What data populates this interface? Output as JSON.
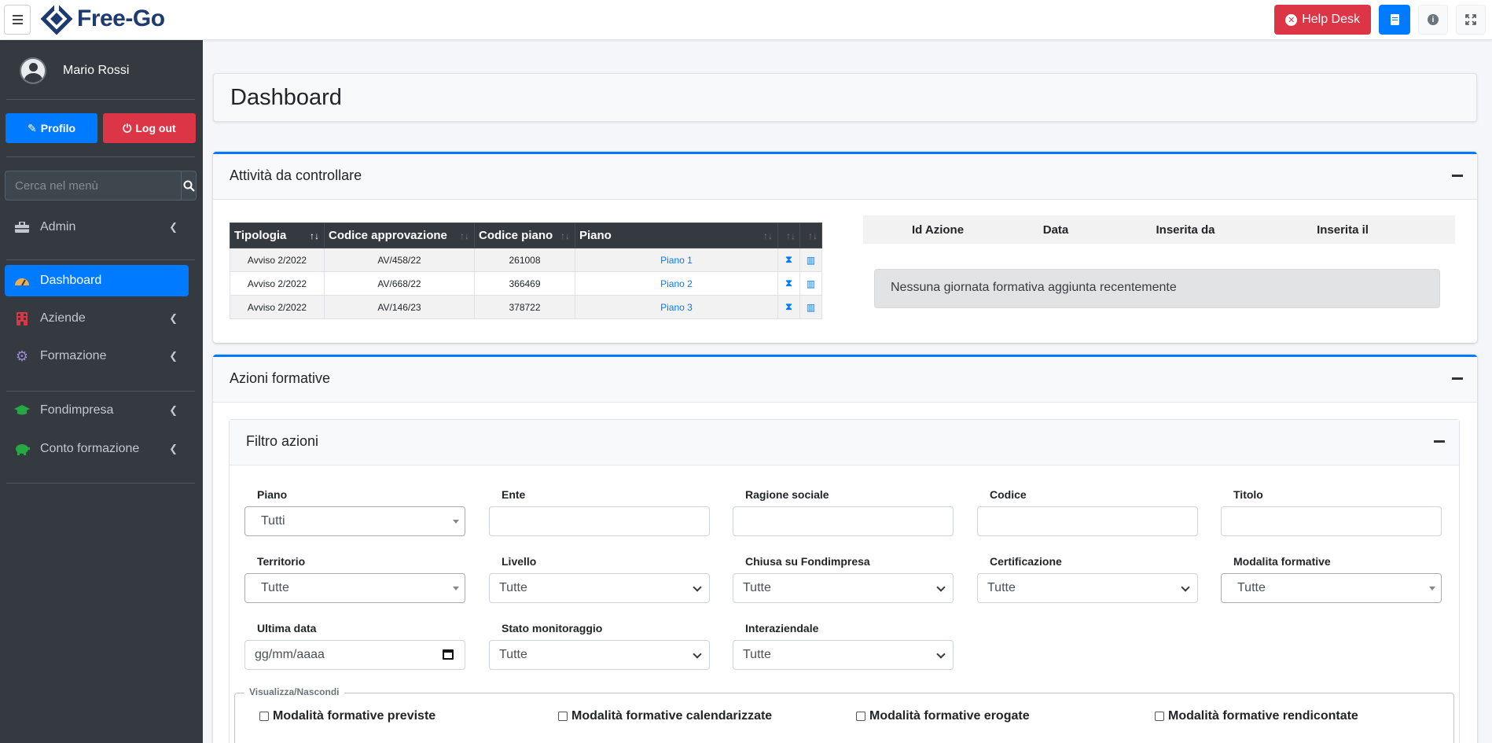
{
  "navbar": {
    "brand": "Free-Go",
    "helpdesk_label": "Help Desk"
  },
  "sidebar": {
    "user_name": "Mario Rossi",
    "profile_label": "Profilo",
    "logout_label": "Log out",
    "search_placeholder": "Cerca nel menù",
    "items": [
      {
        "label": "Admin",
        "icon": "toolbox-icon",
        "has_children": true
      },
      {
        "label": "Dashboard",
        "icon": "dashboard-gauge-icon",
        "active": true
      },
      {
        "label": "Aziende",
        "icon": "building-icon",
        "has_children": true
      },
      {
        "label": "Formazione",
        "icon": "gear-icon",
        "has_children": true
      },
      {
        "label": "Fondimpresa",
        "icon": "graduation-cap-icon",
        "has_children": true
      },
      {
        "label": "Conto formazione",
        "icon": "piggy-bank-icon",
        "has_children": true
      }
    ],
    "colors": {
      "active": "#007bff",
      "background": "#343a40"
    }
  },
  "page": {
    "title": "Dashboard"
  },
  "attivita": {
    "title": "Attività da controllare",
    "columns": [
      "Tipologia",
      "Codice approvazione",
      "Codice piano",
      "Piano"
    ],
    "rows": [
      {
        "tipologia": "Avviso 2/2022",
        "codice_approvazione": "AV/458/22",
        "codice_piano": "261008",
        "piano": "Piano 1"
      },
      {
        "tipologia": "Avviso 2/2022",
        "codice_approvazione": "AV/668/22",
        "codice_piano": "366469",
        "piano": "Piano 2"
      },
      {
        "tipologia": "Avviso 2/2022",
        "codice_approvazione": "AV/146/23",
        "codice_piano": "378722",
        "piano": "Piano 3"
      }
    ],
    "recent_columns": [
      "Id Azione",
      "Data",
      "Inserita da",
      "Inserita il"
    ],
    "empty_message": "Nessuna giornata formativa aggiunta recentemente"
  },
  "azioni": {
    "title": "Azioni formative",
    "filter_title": "Filtro azioni",
    "fields": {
      "piano": {
        "label": "Piano",
        "value": "Tutti"
      },
      "ente": {
        "label": "Ente",
        "value": ""
      },
      "ragione_sociale": {
        "label": "Ragione sociale",
        "value": ""
      },
      "codice": {
        "label": "Codice",
        "value": ""
      },
      "titolo": {
        "label": "Titolo",
        "value": ""
      },
      "territorio": {
        "label": "Territorio",
        "value": "Tutte"
      },
      "livello": {
        "label": "Livello",
        "value": "Tutte"
      },
      "chiusa": {
        "label": "Chiusa su Fondimpresa",
        "value": "Tutte"
      },
      "certificazione": {
        "label": "Certificazione",
        "value": "Tutte"
      },
      "modalita": {
        "label": "Modalita formative",
        "value": "Tutte"
      },
      "ultima_data": {
        "label": "Ultima data",
        "placeholder": "gg/mm/aaaa"
      },
      "stato": {
        "label": "Stato monitoraggio",
        "value": "Tutte"
      },
      "interaziendale": {
        "label": "Interaziendale",
        "value": "Tutte"
      }
    },
    "visibility_legend": "Visualizza/Nascondi",
    "checkboxes": [
      "Modalità formative previste",
      "Modalità formative calendarizzate",
      "Modalità formative erogate",
      "Modalità formative rendicontate"
    ]
  }
}
